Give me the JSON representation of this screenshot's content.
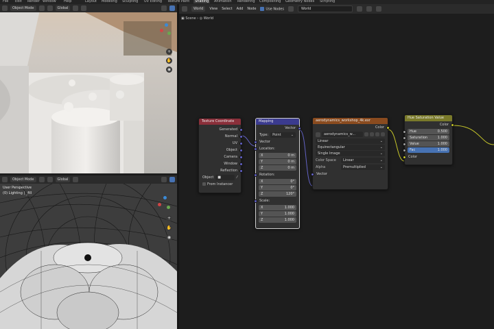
{
  "topbar": {
    "tabs": [
      "File",
      "Edit",
      "Render",
      "Window",
      "Help",
      "Layout",
      "Modeling",
      "Sculpting",
      "UV Editing",
      "Texture Paint",
      "Shading",
      "Animation",
      "Rendering",
      "Compositing",
      "Geometry Nodes",
      "Scripting"
    ],
    "active_tab": "Shading"
  },
  "viewport_top": {
    "mode": "Object Mode",
    "transform": "Global"
  },
  "viewport_bottom": {
    "mode": "Object Mode",
    "transform": "Global",
    "view_name": "User Perspective",
    "collection": "(0) Lighting | _fill"
  },
  "node_editor": {
    "header": {
      "type_dropdown": "World",
      "menus": [
        "View",
        "Select",
        "Add",
        "Node"
      ],
      "use_nodes_label": "Use Nodes",
      "world_field": "World"
    },
    "breadcrumb": {
      "scene": "Scene",
      "world": "World"
    },
    "nodes": {
      "texcoord": {
        "title": "Texture Coordinate",
        "outputs": [
          "Generated",
          "Normal",
          "UV",
          "Object",
          "Camera",
          "Window",
          "Reflection"
        ],
        "object_label": "Object",
        "from_instancer": "From Instancer"
      },
      "mapping": {
        "title": "Mapping",
        "output": "Vector",
        "type_label": "Type:",
        "type_value": "Point",
        "vector_in": "Vector",
        "location_label": "Location:",
        "location": [
          [
            "X",
            "0 m"
          ],
          [
            "Y",
            "0 m"
          ],
          [
            "Z",
            "0 m"
          ]
        ],
        "rotation_label": "Rotation:",
        "rotation": [
          [
            "X",
            "0°"
          ],
          [
            "Y",
            "0°"
          ],
          [
            "Z",
            "120°"
          ]
        ],
        "scale_label": "Scale:",
        "scale": [
          [
            "X",
            "1.000"
          ],
          [
            "Y",
            "1.000"
          ],
          [
            "Z",
            "1.000"
          ]
        ]
      },
      "envtex": {
        "title": "aerodynamics_workshop_4k.exr",
        "output": "Color",
        "image_name": "aerodynamics_w...",
        "interpolation": "Linear",
        "projection": "Equirectangular",
        "source": "Single Image",
        "colorspace_label": "Color Space",
        "colorspace": "Linear",
        "alpha_label": "Alpha",
        "alpha": "Premultiplied",
        "vector_in": "Vector"
      },
      "hsv": {
        "title": "Hue Saturation Value",
        "output": "Color",
        "fields": [
          [
            "Hue",
            "0.500"
          ],
          [
            "Saturation",
            "1.000"
          ],
          [
            "Value",
            "1.000"
          ],
          [
            "Fac",
            "1.000"
          ]
        ],
        "color_in": "Color"
      }
    }
  }
}
